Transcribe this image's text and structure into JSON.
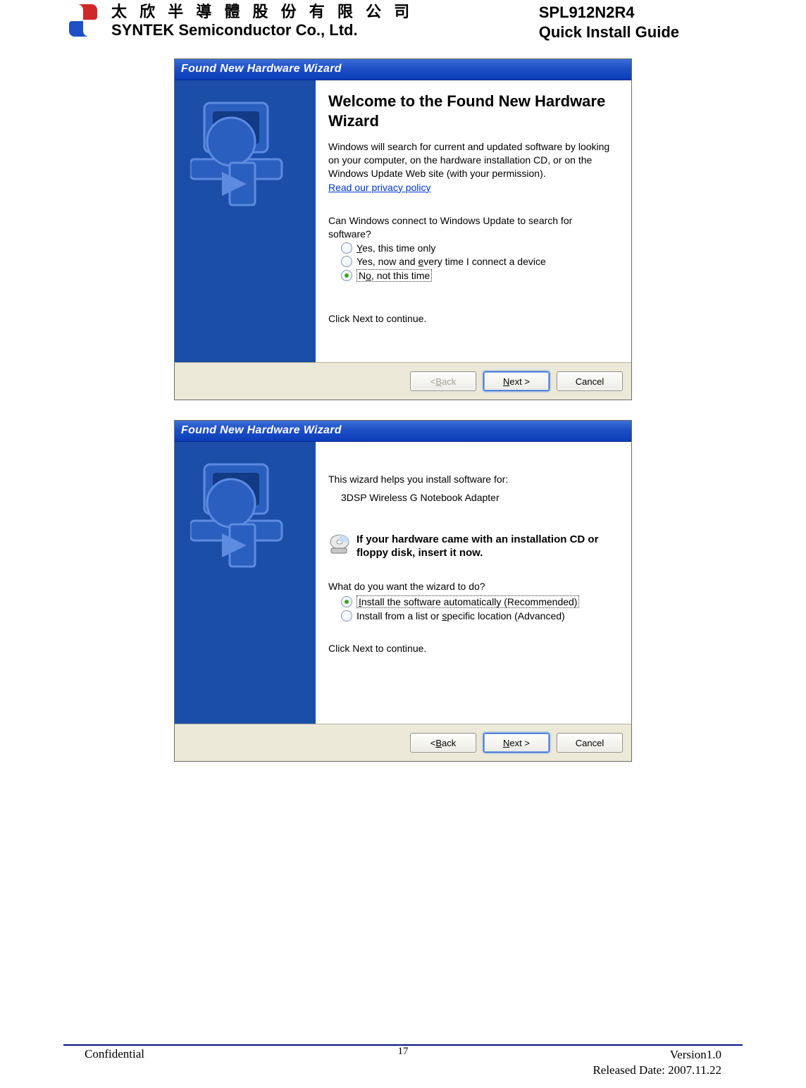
{
  "header": {
    "company_cn": "太 欣 半 導 體 股 份 有 限 公 司",
    "company_en": "SYNTEK Semiconductor Co., Ltd.",
    "product": "SPL912N2R4",
    "doc_type": "Quick Install Guide"
  },
  "wizard1": {
    "title": "Found New Hardware Wizard",
    "heading": "Welcome to the Found New Hardware Wizard",
    "intro": "Windows will search for current and updated software by looking on your computer, on the hardware installation CD, or on the Windows Update Web site (with your permission).",
    "privacy_link": "Read our privacy policy",
    "question": "Can Windows connect to Windows Update to search for software?",
    "options": [
      "Yes, this time only",
      "Yes, now and every time I connect a device",
      "No, not this time"
    ],
    "click_next": "Click Next to continue.",
    "buttons": {
      "back": "< Back",
      "next": "Next >",
      "cancel": "Cancel"
    }
  },
  "wizard2": {
    "title": "Found New Hardware Wizard",
    "helps_text": "This wizard helps you install software for:",
    "device": "3DSP Wireless G Notebook Adapter",
    "cd_text": "If your hardware came with an installation CD or floppy disk, insert it now.",
    "question": "What do you want the wizard to do?",
    "options": [
      "Install the software automatically (Recommended)",
      "Install from a list or specific location (Advanced)"
    ],
    "click_next": "Click Next to continue.",
    "buttons": {
      "back": "< Back",
      "next": "Next >",
      "cancel": "Cancel"
    }
  },
  "footer": {
    "confidential": "Confidential",
    "page": "17",
    "version": "Version1.0",
    "released": "Released Date: 2007.11.22"
  }
}
